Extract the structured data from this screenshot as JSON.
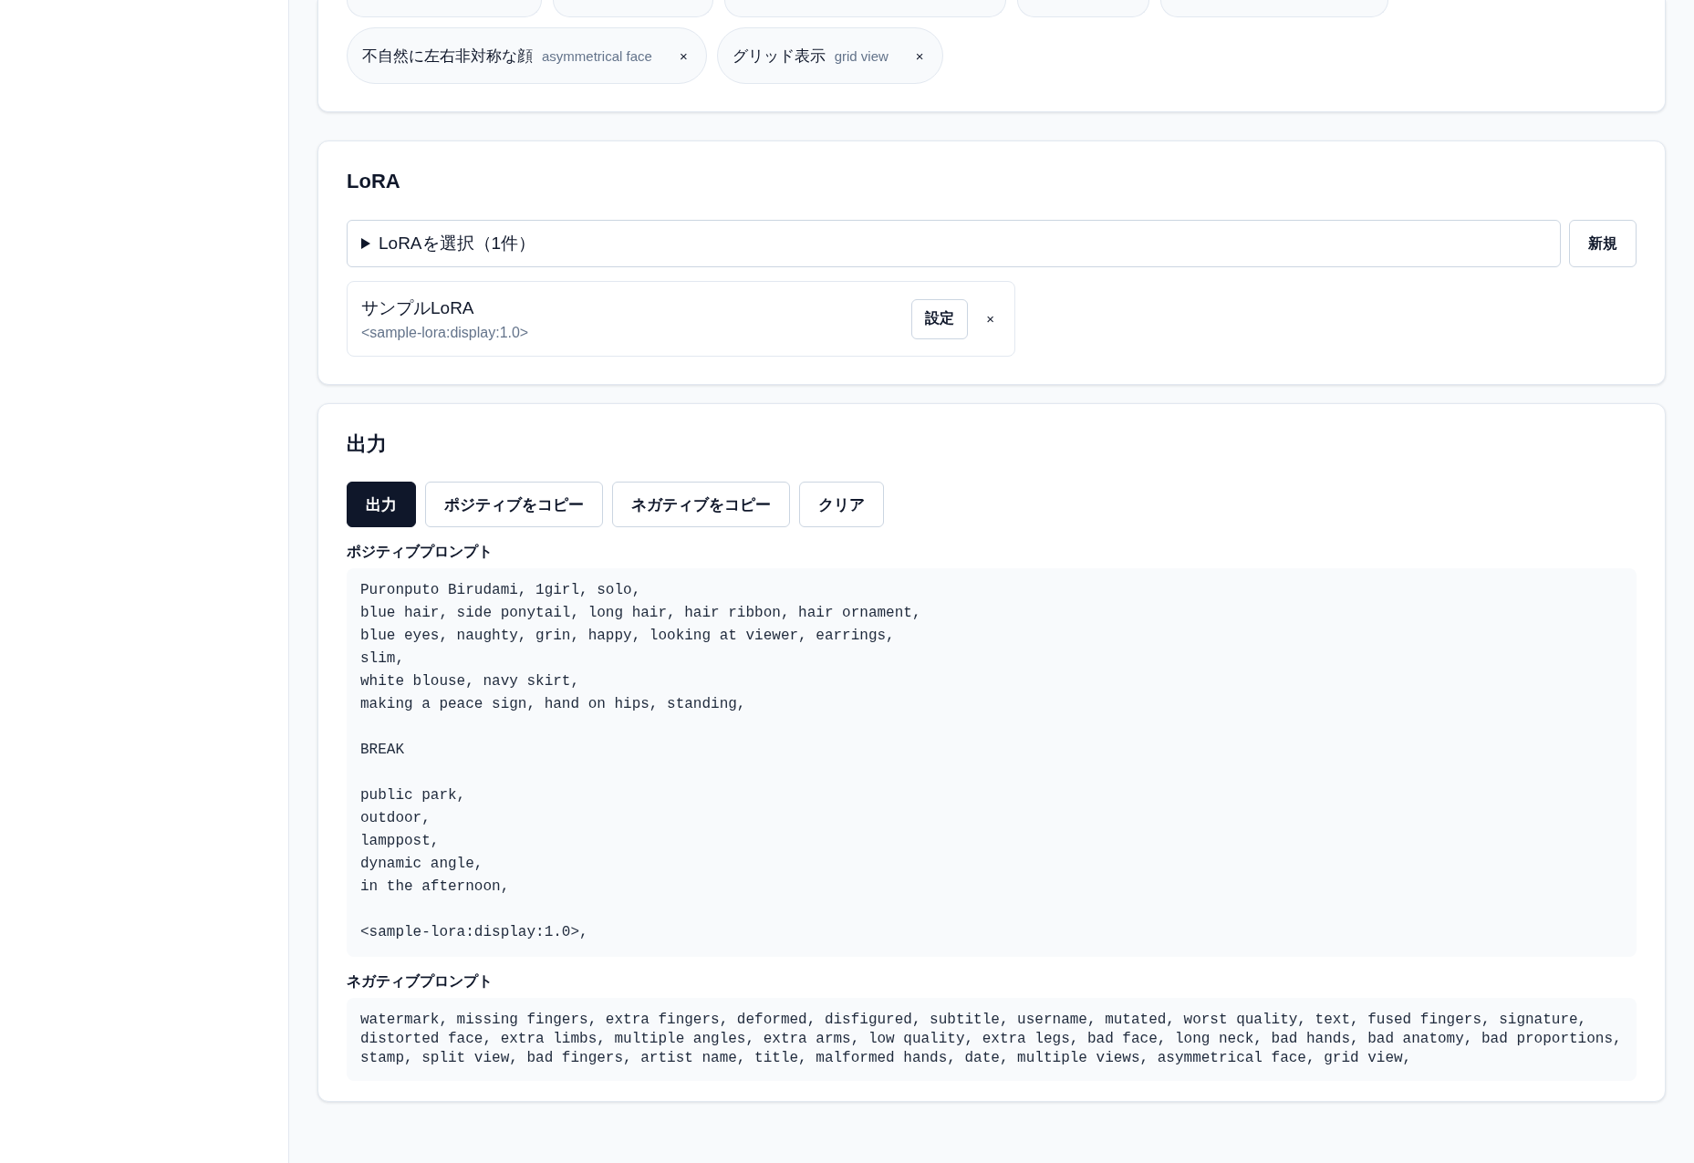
{
  "negative_tags": {
    "chips": [
      {
        "label": "不自然に左右非対称な顔",
        "translation": "asymmetrical face",
        "remove": "×"
      },
      {
        "label": "グリッド表示",
        "translation": "grid view",
        "remove": "×"
      }
    ]
  },
  "lora": {
    "title": "LoRA",
    "selector": {
      "label": "LoRAを選択（1件）",
      "expanded": false
    },
    "new_button": "新規",
    "items": [
      {
        "name": "サンプルLoRA",
        "tag": "<sample-lora:display:1.0>",
        "settings_button": "設定",
        "remove": "×"
      }
    ]
  },
  "output": {
    "title": "出力",
    "buttons": [
      {
        "label": "出力",
        "kind": "primary"
      },
      {
        "label": "ポジティブをコピー",
        "kind": "outline"
      },
      {
        "label": "ネガティブをコピー",
        "kind": "outline"
      },
      {
        "label": "クリア",
        "kind": "outline"
      }
    ],
    "positive_label": "ポジティブプロンプト",
    "positive_prompt": "Puronputo Birudami, 1girl, solo,\nblue hair, side ponytail, long hair, hair ribbon, hair ornament,\nblue eyes, naughty, grin, happy, looking at viewer, earrings,\nslim,\nwhite blouse, navy skirt,\nmaking a peace sign, hand on hips, standing,\n\nBREAK\n\npublic park,\noutdoor,\nlamppost,\ndynamic angle,\nin the afternoon,\n\n<sample-lora:display:1.0>,",
    "negative_label": "ネガティブプロンプト",
    "negative_prompt": "watermark, missing fingers, extra fingers, deformed, disfigured, subtitle, username, mutated, worst quality, text, fused fingers, signature,\ndistorted face, extra limbs, multiple angles, extra arms, low quality, extra legs, bad face, long neck, bad hands, bad anatomy, bad proportions,\nstamp, split view, bad fingers, artist name, title, malformed hands, date, multiple views, asymmetrical face, grid view,"
  }
}
